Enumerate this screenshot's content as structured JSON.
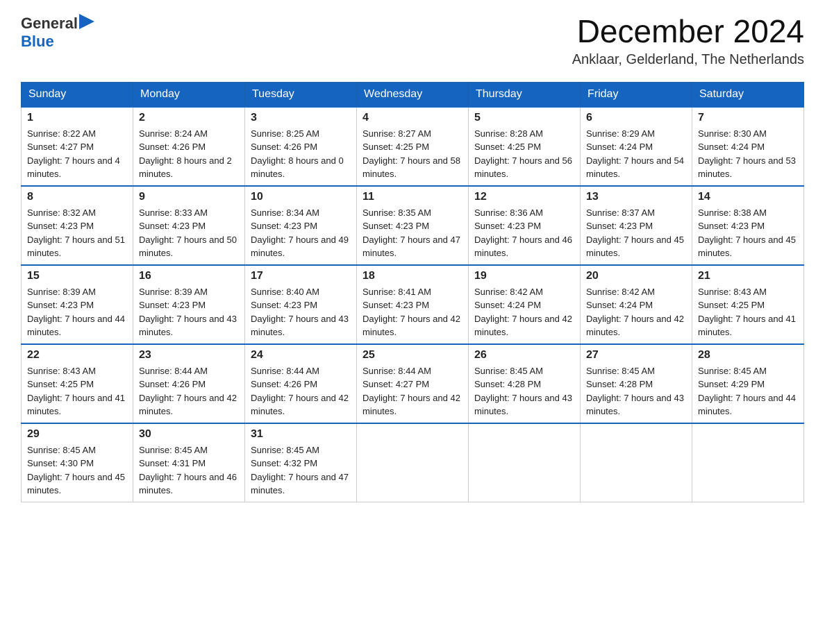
{
  "logo": {
    "text_general": "General",
    "text_blue": "Blue",
    "triangle": "▶"
  },
  "title": {
    "month_year": "December 2024",
    "location": "Anklaar, Gelderland, The Netherlands"
  },
  "weekdays": [
    "Sunday",
    "Monday",
    "Tuesday",
    "Wednesday",
    "Thursday",
    "Friday",
    "Saturday"
  ],
  "weeks": [
    [
      {
        "day": "1",
        "sunrise": "Sunrise: 8:22 AM",
        "sunset": "Sunset: 4:27 PM",
        "daylight": "Daylight: 7 hours and 4 minutes."
      },
      {
        "day": "2",
        "sunrise": "Sunrise: 8:24 AM",
        "sunset": "Sunset: 4:26 PM",
        "daylight": "Daylight: 8 hours and 2 minutes."
      },
      {
        "day": "3",
        "sunrise": "Sunrise: 8:25 AM",
        "sunset": "Sunset: 4:26 PM",
        "daylight": "Daylight: 8 hours and 0 minutes."
      },
      {
        "day": "4",
        "sunrise": "Sunrise: 8:27 AM",
        "sunset": "Sunset: 4:25 PM",
        "daylight": "Daylight: 7 hours and 58 minutes."
      },
      {
        "day": "5",
        "sunrise": "Sunrise: 8:28 AM",
        "sunset": "Sunset: 4:25 PM",
        "daylight": "Daylight: 7 hours and 56 minutes."
      },
      {
        "day": "6",
        "sunrise": "Sunrise: 8:29 AM",
        "sunset": "Sunset: 4:24 PM",
        "daylight": "Daylight: 7 hours and 54 minutes."
      },
      {
        "day": "7",
        "sunrise": "Sunrise: 8:30 AM",
        "sunset": "Sunset: 4:24 PM",
        "daylight": "Daylight: 7 hours and 53 minutes."
      }
    ],
    [
      {
        "day": "8",
        "sunrise": "Sunrise: 8:32 AM",
        "sunset": "Sunset: 4:23 PM",
        "daylight": "Daylight: 7 hours and 51 minutes."
      },
      {
        "day": "9",
        "sunrise": "Sunrise: 8:33 AM",
        "sunset": "Sunset: 4:23 PM",
        "daylight": "Daylight: 7 hours and 50 minutes."
      },
      {
        "day": "10",
        "sunrise": "Sunrise: 8:34 AM",
        "sunset": "Sunset: 4:23 PM",
        "daylight": "Daylight: 7 hours and 49 minutes."
      },
      {
        "day": "11",
        "sunrise": "Sunrise: 8:35 AM",
        "sunset": "Sunset: 4:23 PM",
        "daylight": "Daylight: 7 hours and 47 minutes."
      },
      {
        "day": "12",
        "sunrise": "Sunrise: 8:36 AM",
        "sunset": "Sunset: 4:23 PM",
        "daylight": "Daylight: 7 hours and 46 minutes."
      },
      {
        "day": "13",
        "sunrise": "Sunrise: 8:37 AM",
        "sunset": "Sunset: 4:23 PM",
        "daylight": "Daylight: 7 hours and 45 minutes."
      },
      {
        "day": "14",
        "sunrise": "Sunrise: 8:38 AM",
        "sunset": "Sunset: 4:23 PM",
        "daylight": "Daylight: 7 hours and 45 minutes."
      }
    ],
    [
      {
        "day": "15",
        "sunrise": "Sunrise: 8:39 AM",
        "sunset": "Sunset: 4:23 PM",
        "daylight": "Daylight: 7 hours and 44 minutes."
      },
      {
        "day": "16",
        "sunrise": "Sunrise: 8:39 AM",
        "sunset": "Sunset: 4:23 PM",
        "daylight": "Daylight: 7 hours and 43 minutes."
      },
      {
        "day": "17",
        "sunrise": "Sunrise: 8:40 AM",
        "sunset": "Sunset: 4:23 PM",
        "daylight": "Daylight: 7 hours and 43 minutes."
      },
      {
        "day": "18",
        "sunrise": "Sunrise: 8:41 AM",
        "sunset": "Sunset: 4:23 PM",
        "daylight": "Daylight: 7 hours and 42 minutes."
      },
      {
        "day": "19",
        "sunrise": "Sunrise: 8:42 AM",
        "sunset": "Sunset: 4:24 PM",
        "daylight": "Daylight: 7 hours and 42 minutes."
      },
      {
        "day": "20",
        "sunrise": "Sunrise: 8:42 AM",
        "sunset": "Sunset: 4:24 PM",
        "daylight": "Daylight: 7 hours and 42 minutes."
      },
      {
        "day": "21",
        "sunrise": "Sunrise: 8:43 AM",
        "sunset": "Sunset: 4:25 PM",
        "daylight": "Daylight: 7 hours and 41 minutes."
      }
    ],
    [
      {
        "day": "22",
        "sunrise": "Sunrise: 8:43 AM",
        "sunset": "Sunset: 4:25 PM",
        "daylight": "Daylight: 7 hours and 41 minutes."
      },
      {
        "day": "23",
        "sunrise": "Sunrise: 8:44 AM",
        "sunset": "Sunset: 4:26 PM",
        "daylight": "Daylight: 7 hours and 42 minutes."
      },
      {
        "day": "24",
        "sunrise": "Sunrise: 8:44 AM",
        "sunset": "Sunset: 4:26 PM",
        "daylight": "Daylight: 7 hours and 42 minutes."
      },
      {
        "day": "25",
        "sunrise": "Sunrise: 8:44 AM",
        "sunset": "Sunset: 4:27 PM",
        "daylight": "Daylight: 7 hours and 42 minutes."
      },
      {
        "day": "26",
        "sunrise": "Sunrise: 8:45 AM",
        "sunset": "Sunset: 4:28 PM",
        "daylight": "Daylight: 7 hours and 43 minutes."
      },
      {
        "day": "27",
        "sunrise": "Sunrise: 8:45 AM",
        "sunset": "Sunset: 4:28 PM",
        "daylight": "Daylight: 7 hours and 43 minutes."
      },
      {
        "day": "28",
        "sunrise": "Sunrise: 8:45 AM",
        "sunset": "Sunset: 4:29 PM",
        "daylight": "Daylight: 7 hours and 44 minutes."
      }
    ],
    [
      {
        "day": "29",
        "sunrise": "Sunrise: 8:45 AM",
        "sunset": "Sunset: 4:30 PM",
        "daylight": "Daylight: 7 hours and 45 minutes."
      },
      {
        "day": "30",
        "sunrise": "Sunrise: 8:45 AM",
        "sunset": "Sunset: 4:31 PM",
        "daylight": "Daylight: 7 hours and 46 minutes."
      },
      {
        "day": "31",
        "sunrise": "Sunrise: 8:45 AM",
        "sunset": "Sunset: 4:32 PM",
        "daylight": "Daylight: 7 hours and 47 minutes."
      },
      null,
      null,
      null,
      null
    ]
  ]
}
